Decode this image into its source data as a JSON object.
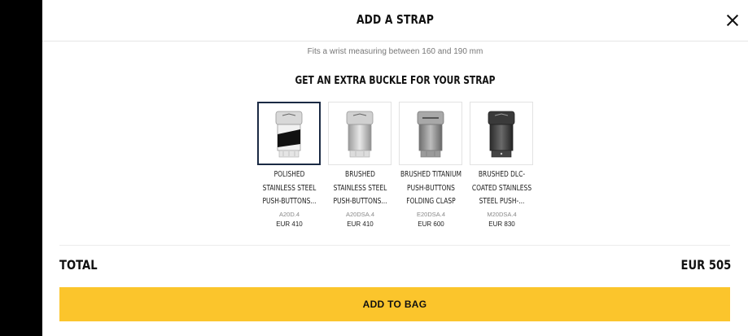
{
  "modal": {
    "title": "ADD A STRAP",
    "fit_note": "Fits a wrist measuring between 160 and 190 mm"
  },
  "buckle_section": {
    "title": "GET AN EXTRA BUCKLE FOR YOUR STRAP",
    "items": [
      {
        "name": "POLISHED STAINLESS STEEL PUSH-BUTTONS...",
        "ref": "A20D.4",
        "price": "EUR 410",
        "selected": true,
        "icon": "polished-buckle-icon"
      },
      {
        "name": "BRUSHED STAINLESS STEEL PUSH-BUTTONS...",
        "ref": "A20DSA.4",
        "price": "EUR 410",
        "selected": false,
        "icon": "brushed-buckle-icon"
      },
      {
        "name": "BRUSHED TITANIUM PUSH-BUTTONS FOLDING CLASP",
        "ref": "E20DSA.4",
        "price": "EUR 600",
        "selected": false,
        "icon": "titanium-buckle-icon"
      },
      {
        "name": "BRUSHED DLC-COATED STAINLESS STEEL PUSH-...",
        "ref": "M20DSA.4",
        "price": "EUR 830",
        "selected": false,
        "icon": "dlc-buckle-icon"
      }
    ]
  },
  "total": {
    "label": "TOTAL",
    "value": "EUR 505"
  },
  "cta": {
    "label": "ADD TO BAG"
  },
  "colors": {
    "accent": "#fbc52c",
    "selected_border": "#1b2a44"
  }
}
